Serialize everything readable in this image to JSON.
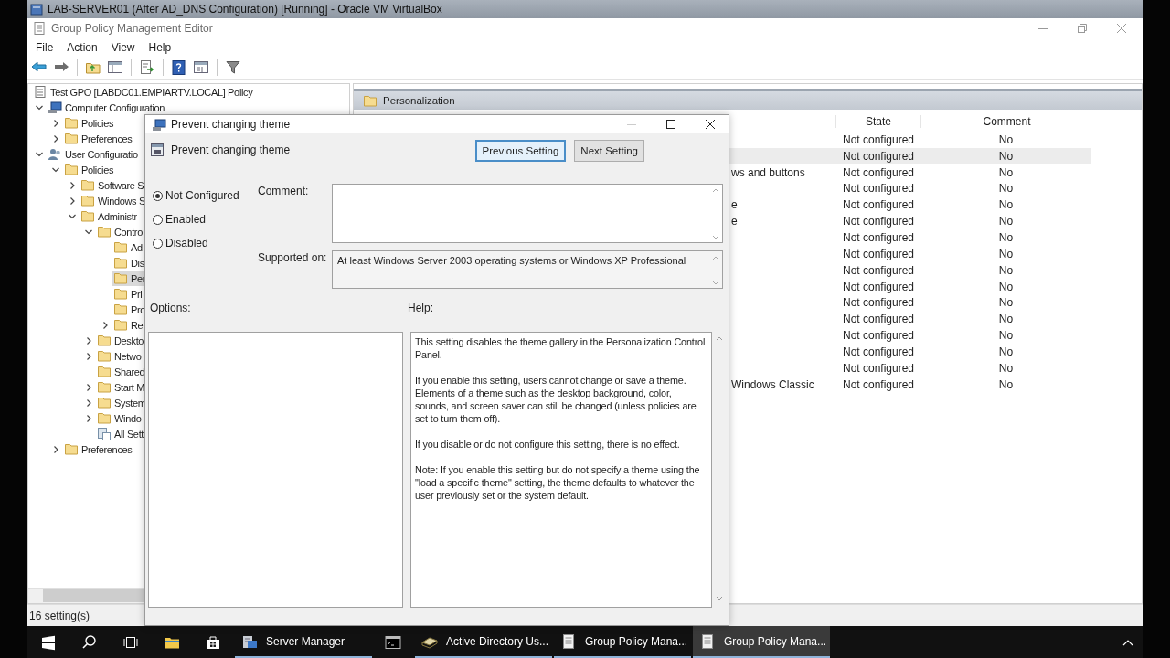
{
  "vm_window": {
    "title": "LAB-SERVER01 (After AD_DNS Configuration) [Running] - Oracle VM VirtualBox"
  },
  "window": {
    "title": "Group Policy Management Editor"
  },
  "menu": [
    "File",
    "Action",
    "View",
    "Help"
  ],
  "tree": {
    "label": "Test GPO [LABDC01.EMPIARTV.LOCAL] Policy",
    "kind": "policy",
    "selected": false,
    "children": [
      {
        "label": "Computer Configuration",
        "kind": "computer",
        "expandable": true,
        "expanded": true,
        "selected": false,
        "children": [
          {
            "label": "Policies",
            "kind": "folder",
            "expandable": true,
            "expanded": false,
            "selected": false
          },
          {
            "label": "Preferences",
            "kind": "folder",
            "expandable": true,
            "expanded": false,
            "selected": false
          }
        ]
      },
      {
        "label": "User Configuratio",
        "kind": "users",
        "expandable": true,
        "expanded": true,
        "selected": false,
        "children": [
          {
            "label": "Policies",
            "kind": "folder",
            "expandable": true,
            "expanded": true,
            "selected": false,
            "children": [
              {
                "label": "Software S",
                "kind": "folder",
                "expandable": true,
                "expanded": false,
                "selected": false
              },
              {
                "label": "Windows S",
                "kind": "folder",
                "expandable": true,
                "expanded": false,
                "selected": false
              },
              {
                "label": "Administr",
                "kind": "folder",
                "expandable": true,
                "expanded": true,
                "selected": false,
                "children": [
                  {
                    "label": "Contro",
                    "kind": "folder",
                    "expandable": true,
                    "expanded": true,
                    "selected": false,
                    "children": [
                      {
                        "label": "Ad",
                        "kind": "folder",
                        "expandable": false,
                        "selected": false
                      },
                      {
                        "label": "Dis",
                        "kind": "folder",
                        "expandable": false,
                        "selected": false
                      },
                      {
                        "label": "Per",
                        "kind": "folder",
                        "expandable": false,
                        "selected": true
                      },
                      {
                        "label": "Pri",
                        "kind": "folder",
                        "expandable": false,
                        "selected": false
                      },
                      {
                        "label": "Pro",
                        "kind": "folder",
                        "expandable": false,
                        "selected": false
                      },
                      {
                        "label": "Re",
                        "kind": "folder",
                        "expandable": true,
                        "expanded": false,
                        "selected": false
                      }
                    ]
                  },
                  {
                    "label": "Deskto",
                    "kind": "folder",
                    "expandable": true,
                    "expanded": false,
                    "selected": false
                  },
                  {
                    "label": "Netwo",
                    "kind": "folder",
                    "expandable": true,
                    "expanded": false,
                    "selected": false
                  },
                  {
                    "label": "Shared",
                    "kind": "folder",
                    "expandable": false,
                    "selected": false
                  },
                  {
                    "label": "Start M",
                    "kind": "folder",
                    "expandable": true,
                    "expanded": false,
                    "selected": false
                  },
                  {
                    "label": "System",
                    "kind": "folder",
                    "expandable": true,
                    "expanded": false,
                    "selected": false
                  },
                  {
                    "label": "Windo",
                    "kind": "folder",
                    "expandable": true,
                    "expanded": false,
                    "selected": false
                  },
                  {
                    "label": "All Sett",
                    "kind": "all-settings",
                    "expandable": false,
                    "selected": false
                  }
                ]
              }
            ]
          },
          {
            "label": "Preferences",
            "kind": "folder",
            "expandable": true,
            "expanded": false,
            "selected": false
          }
        ]
      }
    ]
  },
  "details": {
    "header": "Personalization",
    "columns": [
      "State",
      "Comment"
    ],
    "rows": [
      {
        "state": "Not configured",
        "comment": "No",
        "selected": false
      },
      {
        "state": "Not configured",
        "comment": "No",
        "selected": true
      },
      {
        "setting": "ws and buttons",
        "state": "Not configured",
        "comment": "No",
        "selected": false
      },
      {
        "state": "Not configured",
        "comment": "No",
        "selected": false
      },
      {
        "setting": "e",
        "state": "Not configured",
        "comment": "No",
        "selected": false
      },
      {
        "setting": "e",
        "state": "Not configured",
        "comment": "No",
        "selected": false
      },
      {
        "state": "Not configured",
        "comment": "No",
        "selected": false
      },
      {
        "state": "Not configured",
        "comment": "No",
        "selected": false
      },
      {
        "state": "Not configured",
        "comment": "No",
        "selected": false
      },
      {
        "state": "Not configured",
        "comment": "No",
        "selected": false
      },
      {
        "state": "Not configured",
        "comment": "No",
        "selected": false
      },
      {
        "state": "Not configured",
        "comment": "No",
        "selected": false
      },
      {
        "state": "Not configured",
        "comment": "No",
        "selected": false
      },
      {
        "state": "Not configured",
        "comment": "No",
        "selected": false
      },
      {
        "state": "Not configured",
        "comment": "No",
        "selected": false
      },
      {
        "setting": "Windows Classic",
        "state": "Not configured",
        "comment": "No",
        "selected": false
      }
    ]
  },
  "status_bar": "16 setting(s)",
  "dialog": {
    "title": "Prevent changing theme",
    "setting_name": "Prevent changing theme",
    "buttons": [
      {
        "label": "Previous Setting",
        "focused": true
      },
      {
        "label": "Next Setting",
        "focused": false
      }
    ],
    "options": [
      {
        "label": "Not Configured",
        "selected": true
      },
      {
        "label": "Enabled",
        "selected": false
      },
      {
        "label": "Disabled",
        "selected": false
      }
    ],
    "comment_label": "Comment:",
    "supported_label": "Supported on:",
    "supported_text": "At least Windows Server 2003 operating systems or Windows XP Professional",
    "options_label": "Options:",
    "help_label": "Help:",
    "help": [
      "This setting disables the theme gallery in the Personalization Control Panel.",
      "If you enable this setting, users cannot change or save a theme. Elements of a theme such as the desktop background, color, sounds, and screen saver can still be changed (unless policies are set to turn them off).",
      "If you disable or do not configure this setting, there is no effect.",
      "Note: If you enable this setting but do not specify a theme using the \"load a specific theme\" setting, the theme defaults to whatever the user previously set or the system default."
    ]
  },
  "taskbar": {
    "items": [
      {
        "kind": "start",
        "running": false,
        "selected": false
      },
      {
        "kind": "search",
        "running": false,
        "selected": false
      },
      {
        "kind": "task-view",
        "running": false,
        "selected": false
      },
      {
        "kind": "explorer",
        "running": false,
        "selected": false
      },
      {
        "kind": "store",
        "running": false,
        "selected": false
      },
      {
        "kind": "server-manager",
        "label": "Server Manager",
        "running": true,
        "selected": false
      },
      {
        "kind": "cmd",
        "running": false,
        "selected": false
      },
      {
        "kind": "ad",
        "label": "Active Directory Us...",
        "running": true,
        "selected": false
      },
      {
        "kind": "gpm",
        "label": "Group Policy Mana...",
        "running": true,
        "selected": false
      },
      {
        "kind": "gpedit",
        "label": "Group Policy Mana...",
        "running": true,
        "selected": true
      }
    ]
  }
}
